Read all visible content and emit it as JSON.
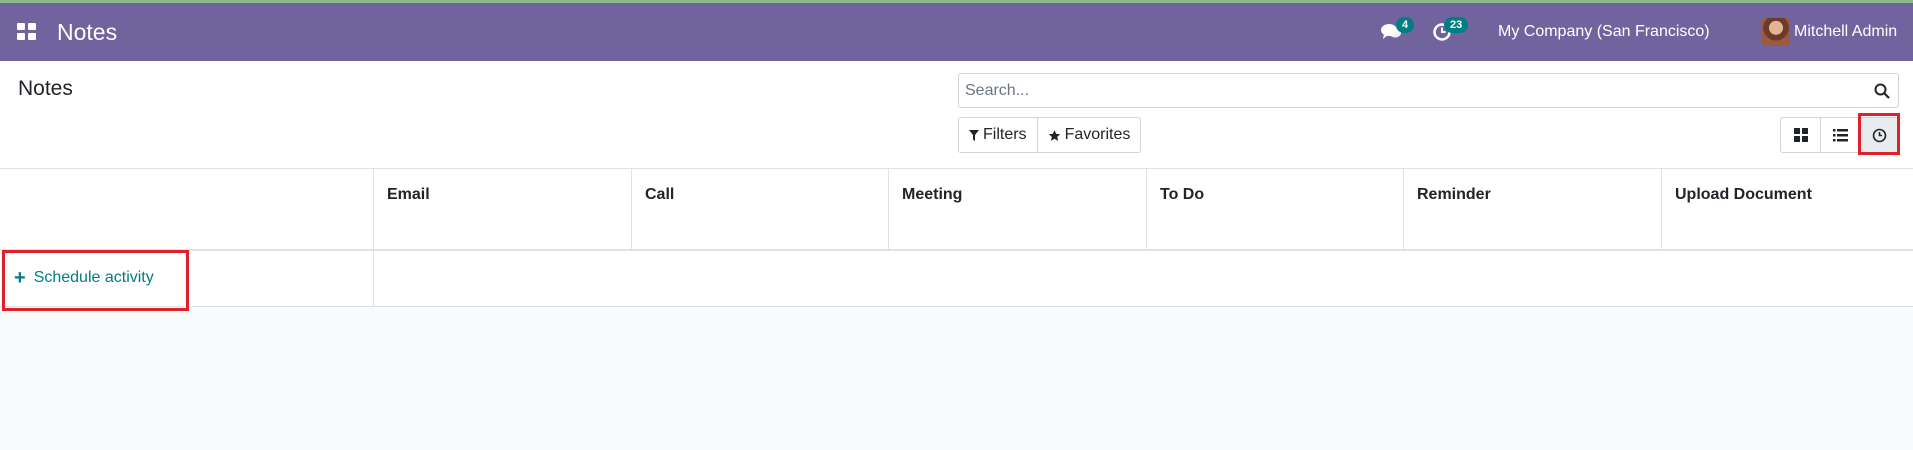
{
  "navbar": {
    "app_title": "Notes",
    "messages_count": "4",
    "activities_count": "23",
    "company": "My Company (San Francisco)",
    "user": "Mitchell Admin"
  },
  "control_panel": {
    "title": "Notes",
    "search_placeholder": "Search...",
    "filters_label": "Filters",
    "favorites_label": "Favorites",
    "views": [
      "kanban-view",
      "list-view",
      "activity-view"
    ],
    "active_view": "activity-view"
  },
  "activity_table": {
    "columns": [
      "Email",
      "Call",
      "Meeting",
      "To Do",
      "Reminder",
      "Upload Document"
    ],
    "schedule_label": "Schedule activity"
  },
  "colors": {
    "navbar": "#71639e",
    "accent": "#017e84",
    "highlight": "#e0212a"
  }
}
